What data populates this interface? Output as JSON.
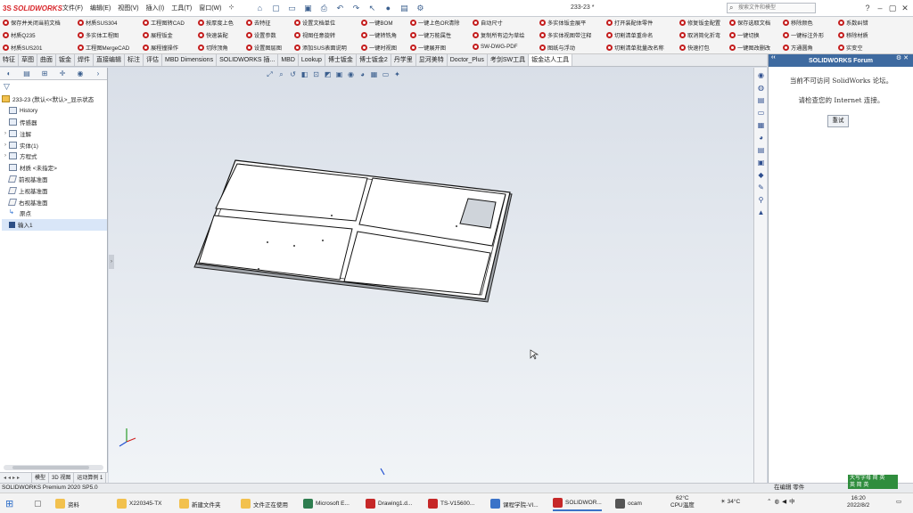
{
  "app": {
    "brand_ds": "3S",
    "brand_name": "SOLIDWORKS",
    "menu": [
      "文件(F)",
      "编辑(E)",
      "视图(V)",
      "插入(I)",
      "工具(T)",
      "窗口(W)"
    ],
    "doc_title": "233-23 *",
    "search_placeholder": "搜索文件和模型"
  },
  "command_rows": [
    [
      "保存并关闭当前文档",
      "材质SUS304",
      "工程图转CAD",
      "按厚度上色",
      "去特征",
      "设置文档单位",
      "一键BOM",
      "一键上色OR清除",
      "自动尺寸",
      "多实体钣金展平",
      "打开装配体零件",
      "修复钣金配置",
      "保存选取文档",
      "移除颜色",
      "系数纠错"
    ],
    [
      "材质Q235",
      "多实体工程图",
      "展程钣金",
      "快速装配",
      "设置参数",
      "视图任意旋转",
      "一键转铣角",
      "一键万能属性",
      "复制所有边为草绘",
      "多实体视图带注释",
      "切割清单重命名",
      "取消简化折弯",
      "一键切换",
      "一键标注外形",
      "移除材质"
    ],
    [
      "材质SUS201",
      "工程图MergeCAD",
      "展程撞操作",
      "切除顶角",
      "设置图层图",
      "添加SUS表面说明",
      "一键时视图",
      "一键展开图",
      "SW-DWG-PDF",
      "图纸与浮动",
      "切割清单批量改名称",
      "快速打包",
      "一键图改删改",
      "方通圆角",
      "实变空"
    ]
  ],
  "tabs": [
    "特征",
    "草图",
    "曲面",
    "钣金",
    "焊件",
    "直接编辑",
    "标注",
    "评估",
    "MBD Dimensions",
    "SOLIDWORKS 插...",
    "MBD",
    "Lookup",
    "博士钣金",
    "博士钣金2",
    "丹学里",
    "显河美特",
    "Doctor_Plus",
    "考剑SW工具",
    "钣金达人工具"
  ],
  "active_tab": "钣金达人工具",
  "tree": {
    "root": "233-23 (默认<<默认>_显示状态",
    "items": [
      {
        "label": "History",
        "type": "folder",
        "arrow": ""
      },
      {
        "label": "传感器",
        "type": "folder",
        "arrow": ""
      },
      {
        "label": "注解",
        "type": "folder",
        "arrow": "›"
      },
      {
        "label": "实体(1)",
        "type": "folder",
        "arrow": "›"
      },
      {
        "label": "方程式",
        "type": "folder",
        "arrow": "›"
      },
      {
        "label": "材质 <未指定>",
        "type": "folder",
        "arrow": ""
      },
      {
        "label": "前视基准面",
        "type": "plane",
        "arrow": ""
      },
      {
        "label": "上视基准面",
        "type": "plane",
        "arrow": ""
      },
      {
        "label": "右视基准面",
        "type": "plane",
        "arrow": ""
      },
      {
        "label": "原点",
        "type": "point",
        "arrow": ""
      },
      {
        "label": "输入1",
        "type": "solid",
        "arrow": ""
      }
    ]
  },
  "bottom_tabs": [
    "模型",
    "3D 视图",
    "运动算例 1"
  ],
  "forum": {
    "title": "SOLIDWORKS Forum",
    "msg1": "当前不可访问 SolidWorks 论坛。",
    "msg2": "请检查您的 Internet 连接。",
    "retry": "重试"
  },
  "status": {
    "left": "SOLIDWORKS Premium 2020 SP5.0",
    "right": "在编辑 零件",
    "ime": "大写字母 简 英",
    "ime2": "英 简 英"
  },
  "taskbar": {
    "items": [
      {
        "label": "资料",
        "color": "#f2c14e"
      },
      {
        "label": "X220345-TX",
        "color": "#f2c14e"
      },
      {
        "label": "新建文件夹",
        "color": "#f2c14e"
      },
      {
        "label": "文件正在使用",
        "color": "#f2c14e"
      },
      {
        "label": "Microsoft E...",
        "color": "#2e7d4f"
      },
      {
        "label": "Drawing1.d...",
        "color": "#c62828"
      },
      {
        "label": "TS-V15600...",
        "color": "#c62828"
      },
      {
        "label": "课程学院-VI...",
        "color": "#3b73c8"
      },
      {
        "label": "SOLIDWOR...",
        "color": "#c62828"
      },
      {
        "label": "ocam",
        "color": "#555555"
      }
    ],
    "cpu_temp": "62°C",
    "cpu_label": "CPU温度",
    "weather": "34°C",
    "time": "16:20",
    "date": "2022/8/2"
  }
}
